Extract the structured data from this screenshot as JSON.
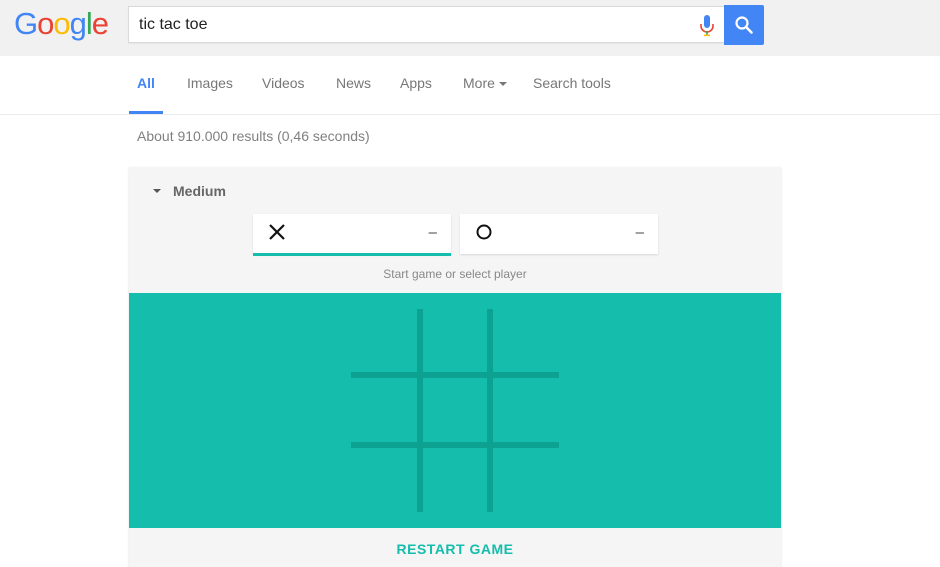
{
  "header": {
    "logo_letters": [
      "G",
      "o",
      "o",
      "g",
      "l",
      "e"
    ],
    "logo_colors": [
      "#4285f4",
      "#ea4335",
      "#fbbc05",
      "#4285f4",
      "#34a853",
      "#ea4335"
    ],
    "search_query": "tic tac toe",
    "mic_icon": "microphone-icon",
    "search_icon": "magnifier-icon"
  },
  "tabs": [
    {
      "label": "All",
      "active": true
    },
    {
      "label": "Images"
    },
    {
      "label": "Videos"
    },
    {
      "label": "News"
    },
    {
      "label": "Apps"
    },
    {
      "label": "More"
    },
    {
      "label": "Search tools"
    }
  ],
  "result_stats": "About 910.000 results (0,46 seconds)",
  "game": {
    "difficulty": "Medium",
    "players": [
      {
        "symbol": "X",
        "score": "–",
        "active": true
      },
      {
        "symbol": "O",
        "score": "–",
        "active": false
      }
    ],
    "hint": "Start game or select player",
    "board_color": "#14bdac",
    "grid_color": "#0da192",
    "restart_label": "RESTART GAME"
  }
}
